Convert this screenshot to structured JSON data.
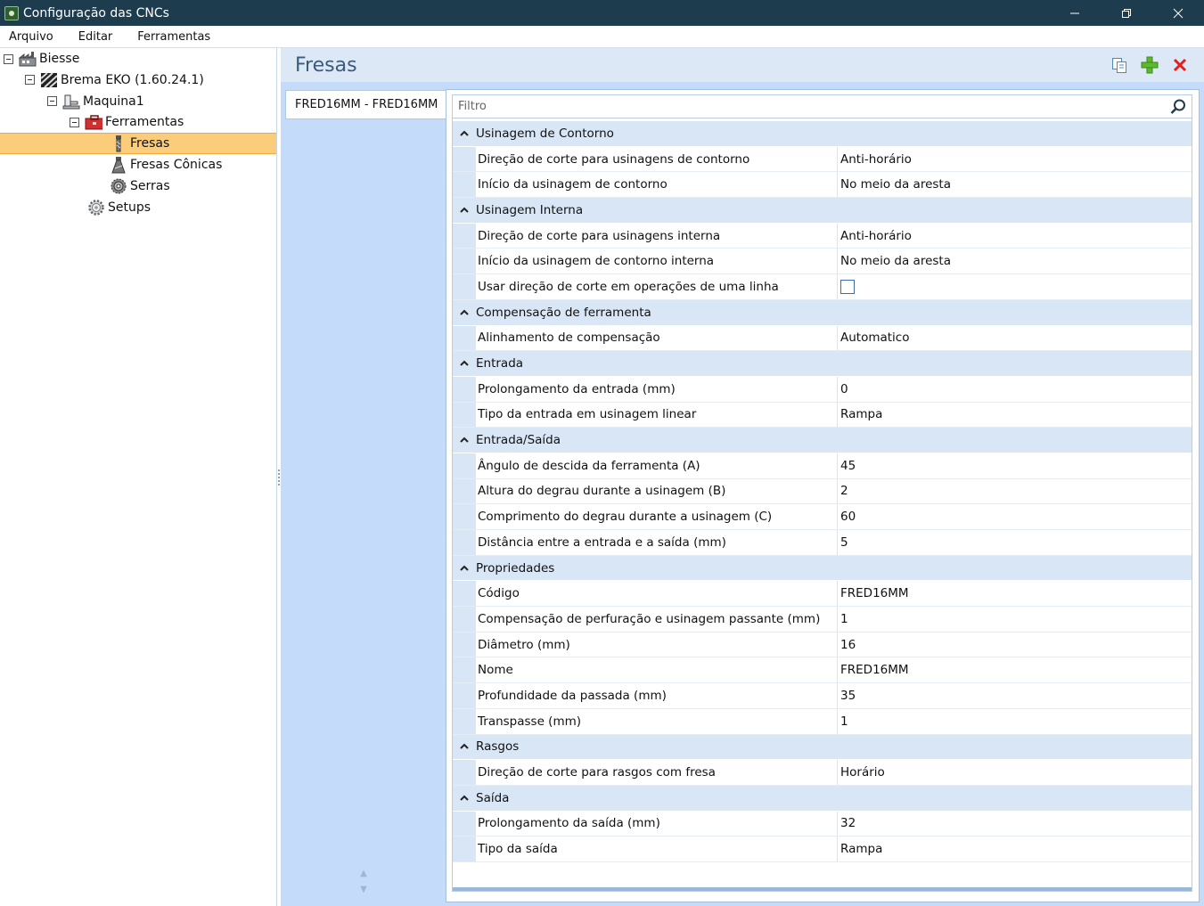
{
  "window": {
    "title": "Configuração das CNCs",
    "minimize_label": "—",
    "maximize_label": "❐",
    "close_label": "✕"
  },
  "menu": [
    "Arquivo",
    "Editar",
    "Ferramentas"
  ],
  "tree": [
    {
      "label": "Biesse",
      "icon": "factory-icon",
      "level": 0,
      "expander": true,
      "selected": false
    },
    {
      "label": "Brema EKO (1.60.24.1)",
      "icon": "machine-stripes-icon",
      "level": 1,
      "expander": true,
      "selected": false
    },
    {
      "label": "Maquina1",
      "icon": "machine-icon",
      "level": 2,
      "expander": true,
      "selected": false
    },
    {
      "label": "Ferramentas",
      "icon": "toolbox-icon",
      "level": 3,
      "expander": true,
      "selected": false
    },
    {
      "label": "Fresas",
      "icon": "mill-icon",
      "level": 4,
      "expander": false,
      "selected": true
    },
    {
      "label": "Fresas Cônicas",
      "icon": "conical-mill-icon",
      "level": 4,
      "expander": false,
      "selected": false
    },
    {
      "label": "Serras",
      "icon": "saw-icon",
      "level": 4,
      "expander": false,
      "selected": false
    },
    {
      "label": "Setups",
      "icon": "gear-icon",
      "level": 3,
      "expander": false,
      "selected": false
    }
  ],
  "panel": {
    "title": "Fresas",
    "actions": [
      "copy-icon",
      "add-icon",
      "delete-icon"
    ]
  },
  "tools": [
    "FRED16MM - FRED16MM"
  ],
  "filter": {
    "placeholder": "Filtro",
    "value": ""
  },
  "colors": {
    "titlebar": "#1d3d4f",
    "selection": "#fbcd7a",
    "panel": "#c4dcfa",
    "category": "#d8e6f6",
    "add": "#5cb82e",
    "delete": "#e02020"
  },
  "grid": [
    {
      "category": "Usinagem de Contorno",
      "props": [
        {
          "name": "Direção de corte para usinagens de contorno",
          "value": "Anti-horário"
        },
        {
          "name": "Início da usinagem de contorno",
          "value": "No meio da aresta"
        }
      ]
    },
    {
      "category": "Usinagem Interna",
      "props": [
        {
          "name": "Direção de corte para usinagens interna",
          "value": "Anti-horário"
        },
        {
          "name": "Início da usinagem de contorno interna",
          "value": "No meio da aresta"
        },
        {
          "name": "Usar direção de corte em operações de uma linha",
          "value": "",
          "checkbox": true,
          "checked": false
        }
      ]
    },
    {
      "category": "Compensação de ferramenta",
      "props": [
        {
          "name": "Alinhamento de compensação",
          "value": "Automatico"
        }
      ]
    },
    {
      "category": "Entrada",
      "props": [
        {
          "name": "Prolongamento da entrada (mm)",
          "value": "0"
        },
        {
          "name": "Tipo da entrada em usinagem linear",
          "value": "Rampa"
        }
      ]
    },
    {
      "category": "Entrada/Saída",
      "props": [
        {
          "name": "Ângulo de descida da ferramenta (A)",
          "value": "45"
        },
        {
          "name": "Altura do degrau durante a usinagem (B)",
          "value": "2"
        },
        {
          "name": "Comprimento do degrau durante a usinagem (C)",
          "value": "60"
        },
        {
          "name": "Distância entre a entrada e a saída (mm)",
          "value": "5"
        }
      ]
    },
    {
      "category": "Propriedades",
      "props": [
        {
          "name": "Código",
          "value": "FRED16MM"
        },
        {
          "name": "Compensação de perfuração e usinagem passante (mm)",
          "value": "1"
        },
        {
          "name": "Diâmetro (mm)",
          "value": "16"
        },
        {
          "name": "Nome",
          "value": "FRED16MM"
        },
        {
          "name": "Profundidade da passada (mm)",
          "value": "35"
        },
        {
          "name": "Transpasse (mm)",
          "value": "1"
        }
      ]
    },
    {
      "category": "Rasgos",
      "props": [
        {
          "name": "Direção de corte para rasgos com fresa",
          "value": "Horário"
        }
      ]
    },
    {
      "category": "Saída",
      "props": [
        {
          "name": "Prolongamento da saída (mm)",
          "value": "32"
        },
        {
          "name": "Tipo da saída",
          "value": "Rampa"
        }
      ]
    }
  ]
}
